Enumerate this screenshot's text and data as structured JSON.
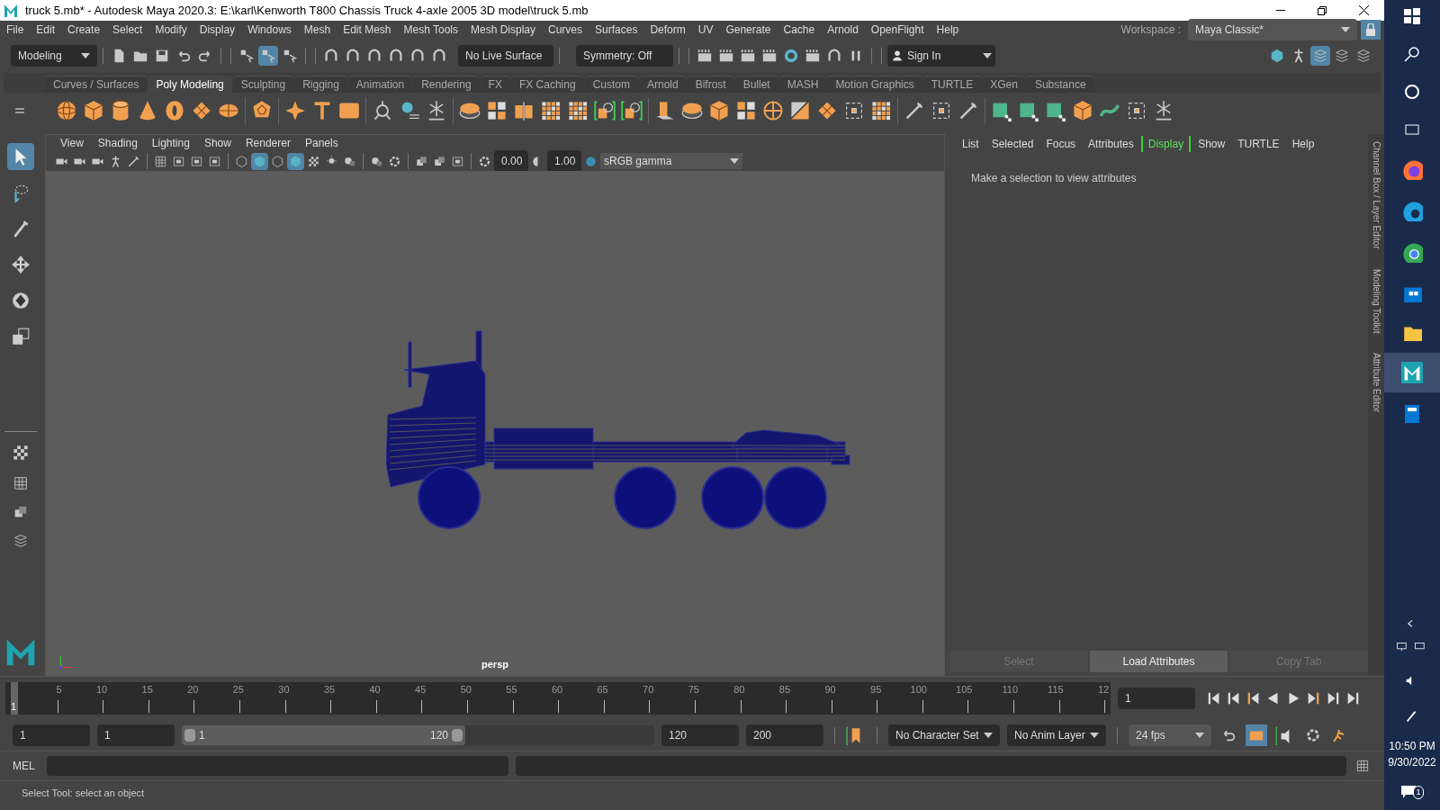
{
  "title_bar": {
    "title": "truck 5.mb* - Autodesk Maya 2020.3: E:\\karl\\Kenworth T800 Chassis Truck 4-axle 2005 3D model\\truck 5.mb"
  },
  "menu": [
    "File",
    "Edit",
    "Create",
    "Select",
    "Modify",
    "Display",
    "Windows",
    "Mesh",
    "Edit Mesh",
    "Mesh Tools",
    "Mesh Display",
    "Curves",
    "Surfaces",
    "Deform",
    "UV",
    "Generate",
    "Cache",
    "Arnold",
    "OpenFlight",
    "Help"
  ],
  "workspace": {
    "label": "Workspace :",
    "value": "Maya Classic*"
  },
  "toolbar": {
    "menu_set": "Modeling",
    "select_modes": [
      {
        "selected": false
      },
      {
        "selected": true
      },
      {
        "selected": false
      }
    ],
    "live_surface": "No Live Surface",
    "symmetry": "Symmetry: Off",
    "sign_in": "Sign In"
  },
  "shelf": {
    "tabs": [
      {
        "label": "Curves / Surfaces",
        "selected": false
      },
      {
        "label": "Poly Modeling",
        "selected": true
      },
      {
        "label": "Sculpting",
        "selected": false
      },
      {
        "label": "Rigging",
        "selected": false
      },
      {
        "label": "Animation",
        "selected": false
      },
      {
        "label": "Rendering",
        "selected": false
      },
      {
        "label": "FX",
        "selected": false
      },
      {
        "label": "FX Caching",
        "selected": false
      },
      {
        "label": "Custom",
        "selected": false
      },
      {
        "label": "Arnold",
        "selected": false
      },
      {
        "label": "Bifrost",
        "selected": false
      },
      {
        "label": "Bullet",
        "selected": false
      },
      {
        "label": "MASH",
        "selected": false
      },
      {
        "label": "Motion Graphics",
        "selected": false
      },
      {
        "label": "TURTLE",
        "selected": false
      },
      {
        "label": "XGen",
        "selected": false
      },
      {
        "label": "Substance",
        "selected": false
      }
    ]
  },
  "tools": [
    {
      "kind": "select",
      "selected": true
    },
    {
      "kind": "lasso",
      "selected": false
    },
    {
      "kind": "paint",
      "selected": false
    },
    {
      "kind": "move",
      "selected": false
    },
    {
      "kind": "rotate",
      "selected": false
    },
    {
      "kind": "scale",
      "selected": false
    }
  ],
  "viewport": {
    "menu": [
      "View",
      "Shading",
      "Lighting",
      "Show",
      "Renderer",
      "Panels"
    ],
    "shading_toggles": [
      {
        "selected": false
      },
      {
        "selected": true
      },
      {
        "selected": false
      },
      {
        "selected": true
      }
    ],
    "exposure": "0.00",
    "gamma": "1.00",
    "color_space": "sRGB gamma",
    "camera": "persp"
  },
  "attribute_editor": {
    "menu": [
      {
        "label": "List",
        "highlighted": false
      },
      {
        "label": "Selected",
        "highlighted": false
      },
      {
        "label": "Focus",
        "highlighted": false
      },
      {
        "label": "Attributes",
        "highlighted": false
      },
      {
        "label": "Display",
        "highlighted": true
      },
      {
        "label": "Show",
        "highlighted": false
      },
      {
        "label": "TURTLE",
        "highlighted": false
      },
      {
        "label": "Help",
        "highlighted": false
      }
    ],
    "message": "Make a selection to view attributes",
    "buttons": [
      {
        "label": "Select",
        "disabled": true
      },
      {
        "label": "Load Attributes",
        "disabled": false
      },
      {
        "label": "Copy Tab",
        "disabled": true
      }
    ]
  },
  "side_tabs": [
    "Channel Box / Layer Editor",
    "Modeling Toolkit",
    "Attribute Editor"
  ],
  "timeline": {
    "current": "1",
    "level": 0,
    "ticks": [
      "5",
      "10",
      "15",
      "20",
      "25",
      "30",
      "35",
      "40",
      "45",
      "50",
      "55",
      "60",
      "65",
      "70",
      "75",
      "80",
      "85",
      "90",
      "95",
      "100",
      "105",
      "110",
      "115",
      "12"
    ],
    "frame_field": "1"
  },
  "range": {
    "start": "1",
    "playback_start": "1",
    "slider_start": "1",
    "slider_end": "120",
    "level": 0.6,
    "playback_end": "120",
    "end": "200",
    "character_set": "No Character Set",
    "anim_layer": "No Anim Layer",
    "fps": "24 fps",
    "cached_playback": true
  },
  "command_line": {
    "label": "MEL"
  },
  "help_line": "Select Tool: select an object",
  "taskbar": {
    "time": "10:50 PM",
    "date": "9/30/2022",
    "notifications": "1"
  }
}
